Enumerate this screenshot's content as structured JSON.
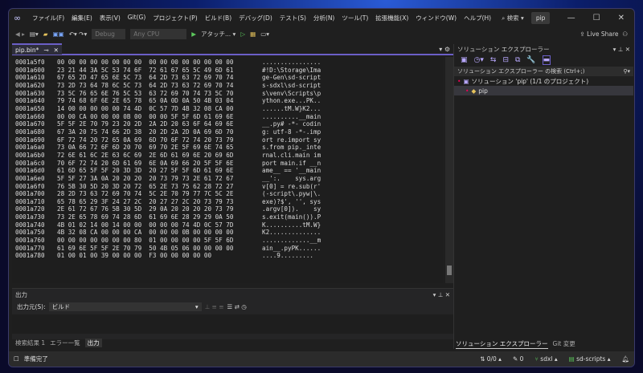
{
  "title": {
    "menus": [
      "ファイル(F)",
      "編集(E)",
      "表示(V)",
      "Git(G)",
      "プロジェクト(P)",
      "ビルド(B)",
      "デバッグ(D)",
      "テスト(S)",
      "分析(N)",
      "ツール(T)",
      "拡張機能(X)",
      "ウィンドウ(W)",
      "ヘルプ(H)"
    ],
    "search": "⌕ 検索 ▾",
    "project": "pip"
  },
  "toolbar": {
    "config": "Debug",
    "platform": "Any CPU",
    "attach": "アタッチ... ▾",
    "live_share": "Live Share"
  },
  "editor": {
    "tab": "pip.bin*",
    "rows": [
      [
        "0001a5f0",
        "00 00 00 00 00 00 00 00  00 00 00 00 00 00 00 00",
        "................"
      ],
      [
        "0001a600",
        "23 21 44 3A 5C 53 74 6F  72 61 67 65 5C 49 6D 61",
        "#!D:\\Storage\\Ima"
      ],
      [
        "0001a610",
        "67 65 2D 47 65 6E 5C 73  64 2D 73 63 72 69 70 74",
        "ge-Gen\\sd-script"
      ],
      [
        "0001a620",
        "73 2D 73 64 78 6C 5C 73  64 2D 73 63 72 69 70 74",
        "s-sdxl\\sd-script"
      ],
      [
        "0001a630",
        "73 5C 76 65 6E 76 5C 53  63 72 69 70 74 73 5C 70",
        "s\\venv\\Scripts\\p"
      ],
      [
        "0001a640",
        "79 74 68 6F 6E 2E 65 78  65 0A 0D 0A 50 4B 03 04",
        "ython.exe...PK.."
      ],
      [
        "0001a650",
        "14 00 00 00 00 00 74 4D  0C 57 7D 4B 32 08 CA 00",
        "......tM.W}K2..."
      ],
      [
        "0001a660",
        "00 00 CA 00 00 00 0B 00  00 00 5F 5F 6D 61 69 6E",
        "..........__main"
      ],
      [
        "0001a670",
        "5F 5F 2E 70 79 23 20 2D  2A 2D 20 63 6F 64 69 6E",
        "__.py# -*- codin"
      ],
      [
        "0001a680",
        "67 3A 20 75 74 66 2D 38  20 2D 2A 2D 0A 69 6D 70",
        "g: utf-8 -*-.imp"
      ],
      [
        "0001a690",
        "6F 72 74 20 72 65 0A 69  6D 70 6F 72 74 20 73 79",
        "ort re.import sy"
      ],
      [
        "0001a6a0",
        "73 0A 66 72 6F 6D 20 70  69 70 2E 5F 69 6E 74 65",
        "s.from pip._inte"
      ],
      [
        "0001a6b0",
        "72 6E 61 6C 2E 63 6C 69  2E 6D 61 69 6E 20 69 6D",
        "rnal.cli.main im"
      ],
      [
        "0001a6c0",
        "70 6F 72 74 20 6D 61 69  6E 0A 69 66 20 5F 5F 6E",
        "port main.if __n"
      ],
      [
        "0001a6d0",
        "61 6D 65 5F 5F 20 3D 3D  20 27 5F 5F 6D 61 69 6E",
        "ame__ == '__main"
      ],
      [
        "0001a6e0",
        "5F 5F 27 3A 0A 20 20 20  20 73 79 73 2E 61 72 67",
        "__':.    sys.arg"
      ],
      [
        "0001a6f0",
        "76 5B 30 5D 20 3D 20 72  65 2E 73 75 62 28 72 27",
        "v[0] = re.sub(r'"
      ],
      [
        "0001a700",
        "28 2D 73 63 72 69 70 74  5C 2E 70 79 77 7C 5C 2E",
        "(-script\\.pyw|\\."
      ],
      [
        "0001a710",
        "65 78 65 29 3F 24 27 2C  20 27 27 2C 20 73 79 73",
        "exe)?$', '', sys"
      ],
      [
        "0001a720",
        "2E 61 72 67 76 5B 30 5D  29 0A 20 20 20 20 73 79",
        ".argv[0]).    sy"
      ],
      [
        "0001a730",
        "73 2E 65 78 69 74 28 6D  61 69 6E 28 29 29 0A 50",
        "s.exit(main()).P"
      ],
      [
        "0001a740",
        "4B 01 02 14 00 14 00 00  00 00 00 74 4D 0C 57 7D",
        "K..........tM.W}"
      ],
      [
        "0001a750",
        "4B 32 08 CA 00 00 00 CA  00 00 00 0B 00 00 00 00",
        "K2.............."
      ],
      [
        "0001a760",
        "00 00 00 00 00 00 00 80  01 00 00 00 00 5F 5F 6D",
        ".............__m"
      ],
      [
        "0001a770",
        "61 69 6E 5F 5F 2E 70 79  50 4B 05 06 00 00 00 00",
        "ain__.pyPK......"
      ],
      [
        "0001a780",
        "01 00 01 00 39 00 00 00  F3 00 00 00 00 00",
        "....9........."
      ]
    ]
  },
  "output": {
    "title": "出力",
    "source_label": "出力元(S):",
    "source": "ビルド"
  },
  "bottom_tabs": [
    "検索結果 1",
    "エラー一覧",
    "出力"
  ],
  "solution": {
    "title": "ソリューション エクスプローラー",
    "search": "ソリューション エクスプローラー の検索 (Ctrl+;)",
    "root": "ソリューション 'pip' (1/1 のプロジェクト)",
    "project": "pip",
    "tabs": [
      "ソリューション エクスプローラー",
      "Git 変更"
    ]
  },
  "status": {
    "ready": "準備完了",
    "changes": "⇅ 0/0 ▴",
    "edits": "✎ 0",
    "branch": "sdxl ▴",
    "repo": "sd-scripts ▴"
  }
}
